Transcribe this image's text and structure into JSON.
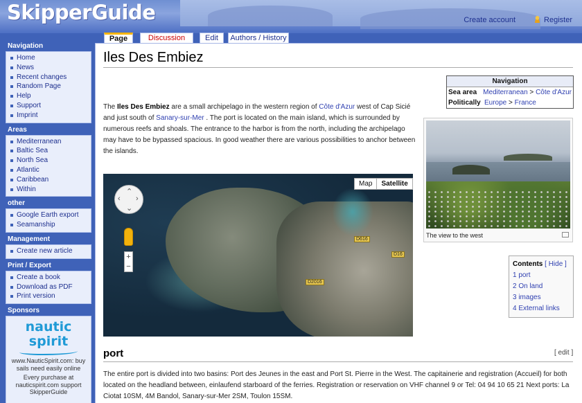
{
  "site": {
    "logo": "SkipperGuide",
    "create_account": "Create account",
    "register": "Register"
  },
  "tabs": {
    "page": "Page",
    "discussion": "Discussion",
    "edit": "Edit",
    "history": "Authors / History"
  },
  "sidebar": {
    "navigation": {
      "title": "Navigation",
      "items": [
        "Home",
        "News",
        "Recent changes",
        "Random Page",
        "Help",
        "Support",
        "Imprint"
      ]
    },
    "areas": {
      "title": "Areas",
      "items": [
        "Mediterranean",
        "Baltic Sea",
        "North Sea",
        "Atlantic",
        "Caribbean",
        "Within"
      ]
    },
    "other": {
      "title": "other",
      "items": [
        "Google Earth export",
        "Seamanship"
      ]
    },
    "management": {
      "title": "Management",
      "items": [
        "Create new article"
      ]
    },
    "print": {
      "title": "Print / Export",
      "items": [
        "Create a book",
        "Download as PDF",
        "Print version"
      ]
    },
    "sponsors": {
      "title": "Sponsors",
      "logo_line1": "nautic",
      "logo_line2": "spirit",
      "url_text": "www.NauticSpirit.com: buy sails need easily online",
      "note": "Every purchase at nauticspirit.com support SkipperGuide"
    }
  },
  "main": {
    "title": "Iles Des Embiez",
    "intro": {
      "p1": "The ",
      "bold": "Iles Des Embiez",
      "p2": " are a small archipelago in the western region of ",
      "link1": "Côte d'Azur",
      "p3": " west of Cap Sicié and just south of ",
      "link2": "Sanary-sur-Mer",
      "p4": " . The port is located on the main island, which is surrounded by numerous reefs and shoals. The entrance to the harbor is from the north, including the archipelago may have to be bypassed spacious. In good weather there are various possibilities to anchor between the islands."
    },
    "infobox": {
      "header": "Navigation",
      "sea_area_label": "Sea area",
      "sea_area_1": "Mediterranean",
      "sea_area_sep": " > ",
      "sea_area_2": "Côte d'Azur",
      "politically_label": "Politically",
      "pol_1": "Europe",
      "pol_sep": " > ",
      "pol_2": "France"
    },
    "thumb_caption": "The view to the west",
    "map": {
      "btn_map": "Map",
      "btn_satellite": "Satellite",
      "roads": [
        "D616",
        "D16",
        "D2016"
      ],
      "zoom_in": "+",
      "zoom_out": "−"
    },
    "toc": {
      "title": "Contents",
      "hide_left": " [ ",
      "hide": "Hide",
      "hide_right": " ]",
      "items": [
        "1 port",
        "2 On land",
        "3 images",
        "4 External links"
      ]
    },
    "section": {
      "title": "port",
      "edit": "[ edit ]",
      "text": "The entire port is divided into two basins: Port des Jeunes in the east and Port St. Pierre in the West. The capitainerie and registration (Accueil) for both located on the headland between, einlaufend starboard of the ferries. Registration or reservation on VHF channel 9 or Tel: 04 94 10 65 21 Next ports: La Ciotat 10SM, 4M Bandol, Sanary-sur-Mer 2SM, Toulon 15SM."
    }
  },
  "colors": {
    "sidebar_bg": "#3f62b8",
    "link": "#2e3fb0",
    "tab_accent": "#f5b400"
  }
}
